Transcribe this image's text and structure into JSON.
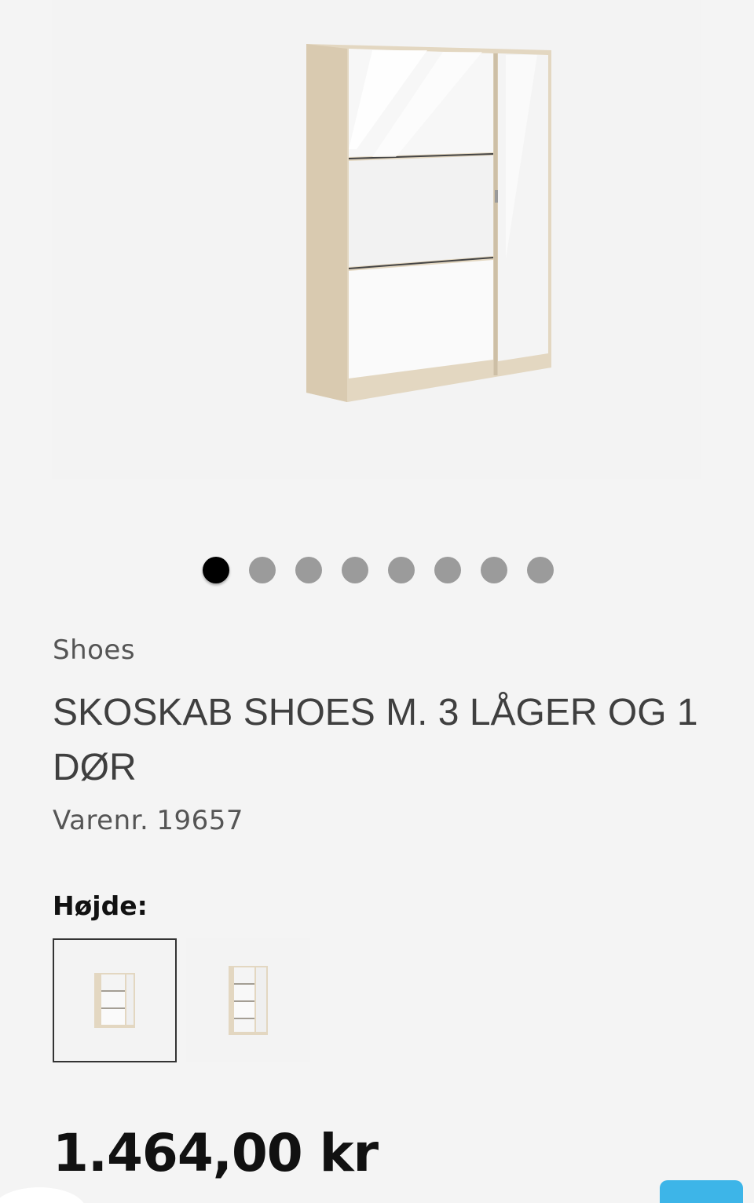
{
  "product": {
    "image_icon": "shoe-cabinet-image",
    "brand": "Shoes",
    "title": "SKOSKAB SHOES M. 3 LÅGER OG 1 DØR",
    "sku_label": "Varenr.",
    "sku_number": "19657",
    "price": "1.464,00 kr"
  },
  "carousel": {
    "total": 8,
    "active_index": 0
  },
  "variants": {
    "label": "Højde:",
    "options": [
      {
        "icon": "shoe-cabinet-low-thumbnail",
        "selected": true
      },
      {
        "icon": "shoe-cabinet-tall-thumbnail",
        "selected": false
      }
    ]
  },
  "colors": {
    "background": "#f4f4f4",
    "accent": "#3db5e8",
    "dot_active": "#000000",
    "dot_inactive": "#9b9b9b"
  }
}
